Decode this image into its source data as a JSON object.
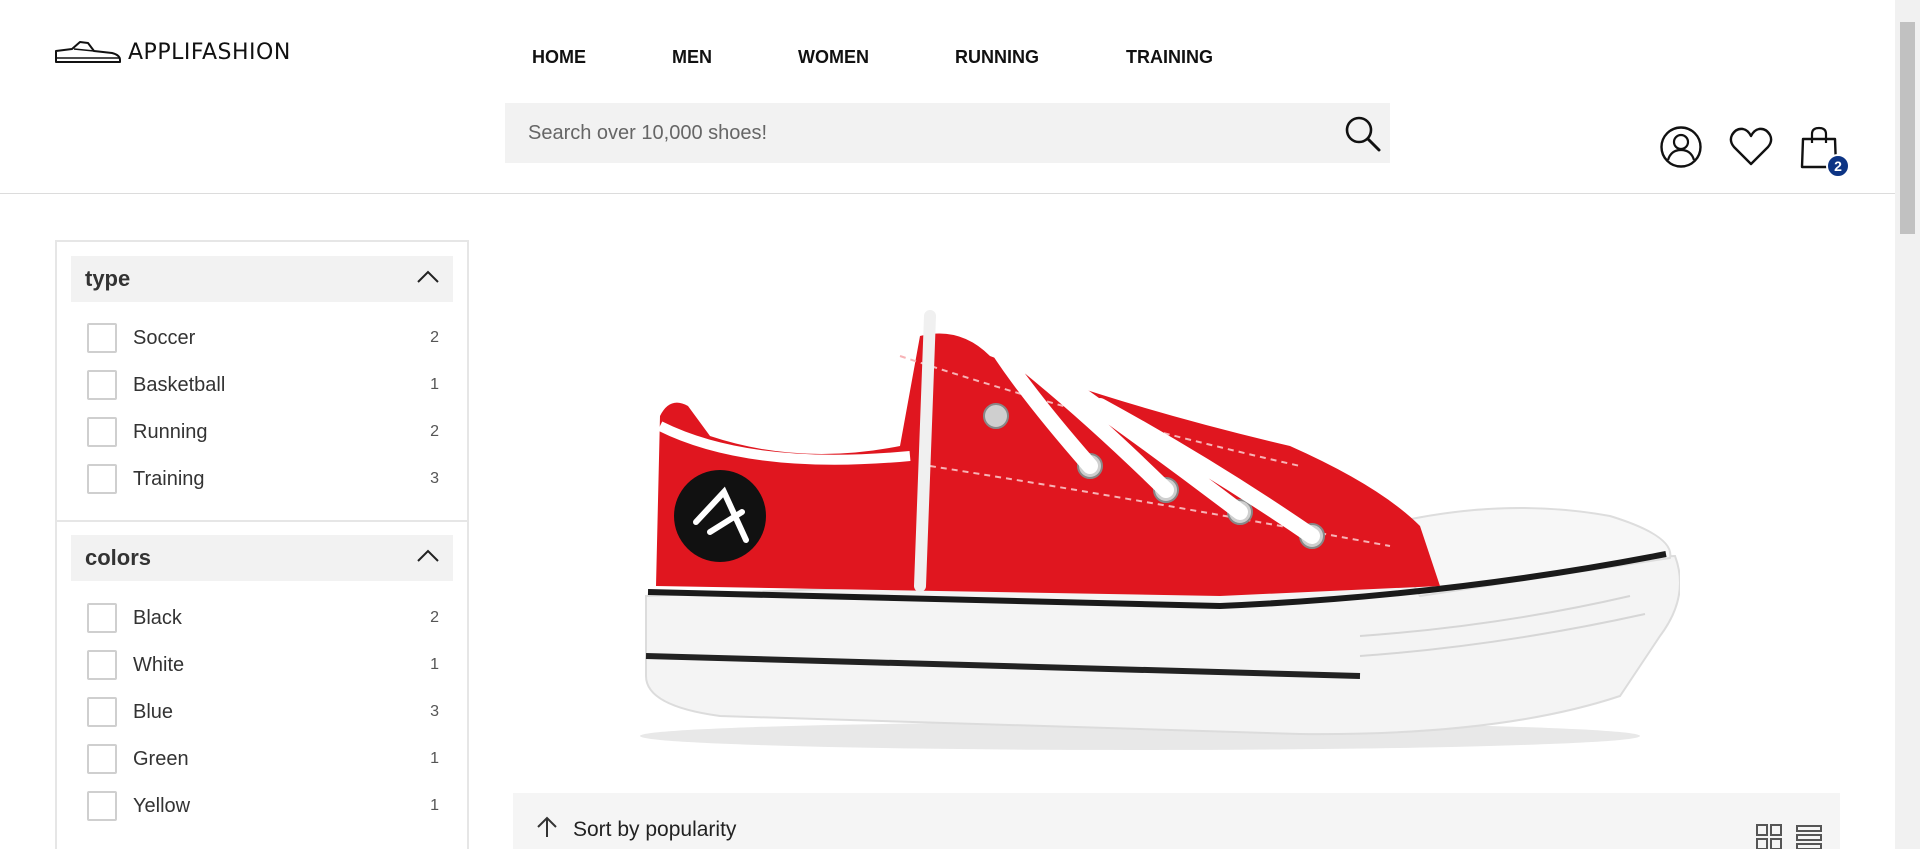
{
  "brand": {
    "name": "APPLIFASHION"
  },
  "nav": {
    "items": [
      {
        "label": "HOME"
      },
      {
        "label": "MEN"
      },
      {
        "label": "WOMEN"
      },
      {
        "label": "RUNNING"
      },
      {
        "label": "TRAINING"
      }
    ]
  },
  "search": {
    "placeholder": "Search over 10,000 shoes!",
    "value": ""
  },
  "cart": {
    "count": "2"
  },
  "filters": [
    {
      "title": "type",
      "options": [
        {
          "label": "Soccer",
          "count": "2",
          "checked": false
        },
        {
          "label": "Basketball",
          "count": "1",
          "checked": false
        },
        {
          "label": "Running",
          "count": "2",
          "checked": false
        },
        {
          "label": "Training",
          "count": "3",
          "checked": false
        }
      ]
    },
    {
      "title": "colors",
      "options": [
        {
          "label": "Black",
          "count": "2",
          "checked": false
        },
        {
          "label": "White",
          "count": "1",
          "checked": false
        },
        {
          "label": "Blue",
          "count": "3",
          "checked": false
        },
        {
          "label": "Green",
          "count": "1",
          "checked": false
        },
        {
          "label": "Yellow",
          "count": "1",
          "checked": false
        }
      ]
    }
  ],
  "sort": {
    "label": "Sort by popularity"
  },
  "icons": {
    "search": "search-icon",
    "account": "user-icon",
    "wishlist": "heart-icon",
    "cart": "shopping-bag-icon",
    "collapse": "chevron-up-icon",
    "sort": "arrow-up-icon",
    "grid_view": "grid-view-icon",
    "list_view": "list-view-icon"
  },
  "colors": {
    "accent": "#0d3484",
    "shoe_red": "#e0161f",
    "panel_bg": "#f2f2f2"
  }
}
